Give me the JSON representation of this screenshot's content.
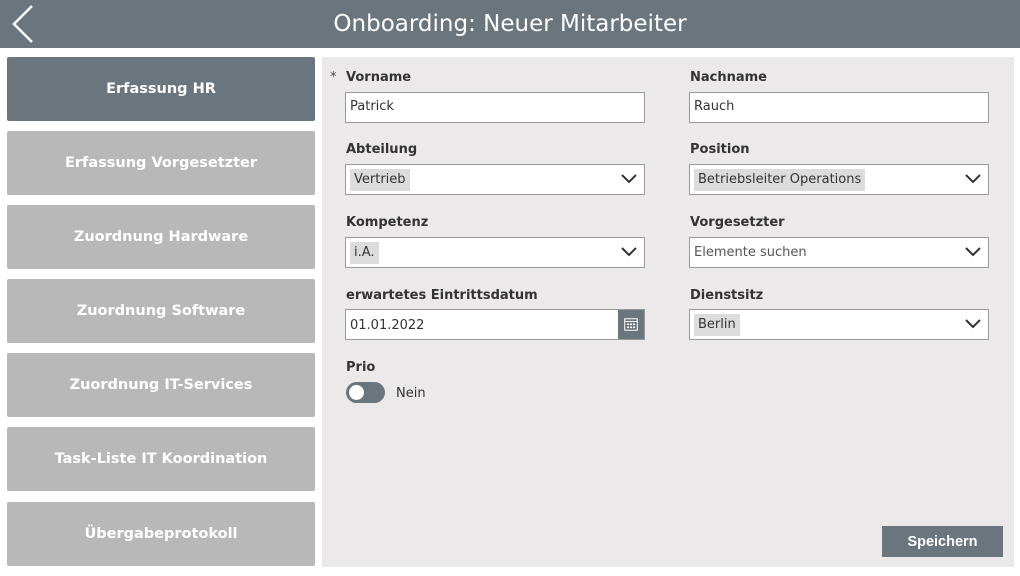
{
  "header": {
    "title": "Onboarding: Neuer Mitarbeiter"
  },
  "nav": {
    "items": [
      {
        "label": "Erfassung HR"
      },
      {
        "label": "Erfassung Vorgesetzter"
      },
      {
        "label": "Zuordnung Hardware"
      },
      {
        "label": "Zuordnung Software"
      },
      {
        "label": "Zuordnung IT-Services"
      },
      {
        "label": "Task-Liste IT Koordination"
      },
      {
        "label": "Übergabeprotokoll"
      }
    ]
  },
  "form": {
    "required_marker": "*",
    "vorname": {
      "label": "Vorname",
      "value": "Patrick"
    },
    "nachname": {
      "label": "Nachname",
      "value": "Rauch"
    },
    "abteilung": {
      "label": "Abteilung",
      "value": "Vertrieb"
    },
    "position": {
      "label": "Position",
      "value": "Betriebsleiter Operations"
    },
    "kompetenz": {
      "label": "Kompetenz",
      "value": "i.A."
    },
    "vorgesetzter": {
      "label": "Vorgesetzter",
      "placeholder": "Elemente suchen"
    },
    "eintrittsdatum": {
      "label": "erwartetes Eintrittsdatum",
      "value": "01.01.2022"
    },
    "dienstsitz": {
      "label": "Dienstsitz",
      "value": "Berlin"
    },
    "prio": {
      "label": "Prio",
      "state_text": "Nein"
    }
  },
  "actions": {
    "save_label": "Speichern"
  },
  "colors": {
    "accent": "#6a757d",
    "nav_inactive": "#b8b8b8",
    "panel_bg": "#ebe9ea"
  }
}
